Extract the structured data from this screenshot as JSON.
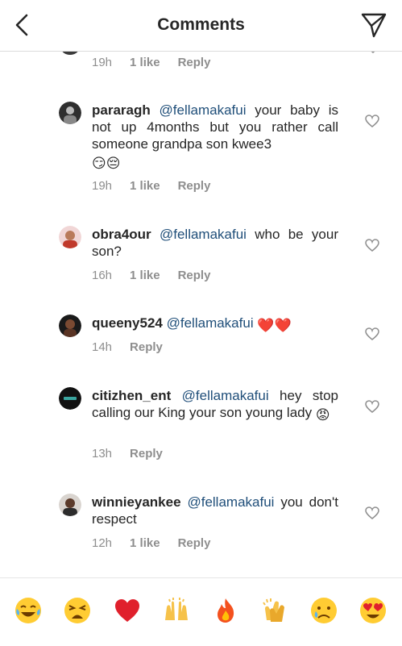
{
  "header": {
    "title": "Comments"
  },
  "partial_comment": {
    "time": "19h",
    "likes": "1 like",
    "reply": "Reply"
  },
  "comments": [
    {
      "username": "pararagh",
      "mention": "@fellamakafui",
      "text": " your baby is not up 4months but you rather call someone grandpa son kwee3",
      "emoji": "😏😔",
      "time": "19h",
      "likes": "1 like",
      "reply": "Reply"
    },
    {
      "username": "obra4our",
      "mention": "@fellamakafui",
      "text": " who be your son?",
      "emoji": "",
      "time": "16h",
      "likes": "1 like",
      "reply": "Reply"
    },
    {
      "username": "queeny524",
      "mention": "@fellamakafui",
      "text": " ",
      "emoji": "❤️❤️",
      "time": "14h",
      "likes": "",
      "reply": "Reply"
    },
    {
      "username": "citizhen_ent",
      "mention": "@fellamakafui",
      "text": " hey stop calling our King your son young lady",
      "emoji": "😡",
      "time": "13h",
      "likes": "",
      "reply": "Reply"
    },
    {
      "username": "winnieyankee",
      "mention": "@fellamakafui",
      "text": " you don't respect",
      "emoji": "",
      "time": "12h",
      "likes": "1 like",
      "reply": "Reply"
    }
  ],
  "quick_emojis": [
    "😂",
    "😩",
    "❤️",
    "🙌",
    "🔥",
    "👏",
    "😢",
    "😍"
  ],
  "colors": {
    "mention": "#1f4e79",
    "meta": "#8e8e8e",
    "divider": "#dbdbdb",
    "text": "#262626"
  }
}
